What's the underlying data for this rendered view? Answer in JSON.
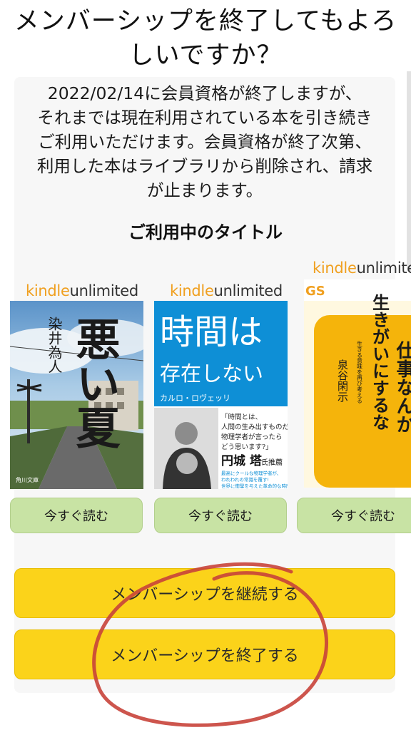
{
  "page": {
    "title_line1": "メンバーシップを終了してもよろ",
    "title_line2": "しいですか？"
  },
  "message": {
    "line1": "2022/02/14に会員資格が終了しますが、",
    "line2": "それまでは現在利用されている本を引き続き",
    "line3": "ご利用いただけます。会員資格が終了次第、",
    "line4": "利用した本はライブラリから削除され、請求",
    "line5": "が止まります。"
  },
  "section": {
    "title": "ご利用中のタイトル"
  },
  "brand": {
    "kindle": "kindle",
    "unlimited": "unlimited"
  },
  "books": [
    {
      "title": "悪い夏",
      "author": "染井為人",
      "publisher": "角川文庫",
      "read_label": "今すぐ読む"
    },
    {
      "title_line1": "時間は",
      "title_line2": "存在しない",
      "author": "カルロ・ロヴェッリ",
      "quote1": "「時間とは、",
      "quote2": "人間の生み出すものだと、",
      "quote3": "物理学者が言ったら",
      "quote4": "どう思います?」",
      "endorser": "円城 塔",
      "endorse_suffix": "氏推薦",
      "blurb1": "最高にクールな物理学者が、",
      "blurb2": "われわれの常識を覆す!",
      "blurb3": "世界に衝撃を与えた革命的な時間論",
      "read_label": "今すぐ読む"
    },
    {
      "series": "GS",
      "title_line1": "仕事なんか",
      "title_line2": "生きがいにするな",
      "subtitle": "生きる意味を再び考える",
      "author": "泉谷閑示",
      "read_label": "今すぐ読む"
    }
  ],
  "actions": {
    "continue_label": "メンバーシップを継続する",
    "end_label": "メンバーシップを終了する"
  },
  "colors": {
    "cta_yellow": "#fbd31a",
    "read_green": "#c8e3a4",
    "annotation_red": "#c8433a",
    "kindle_orange": "#f0a020"
  }
}
